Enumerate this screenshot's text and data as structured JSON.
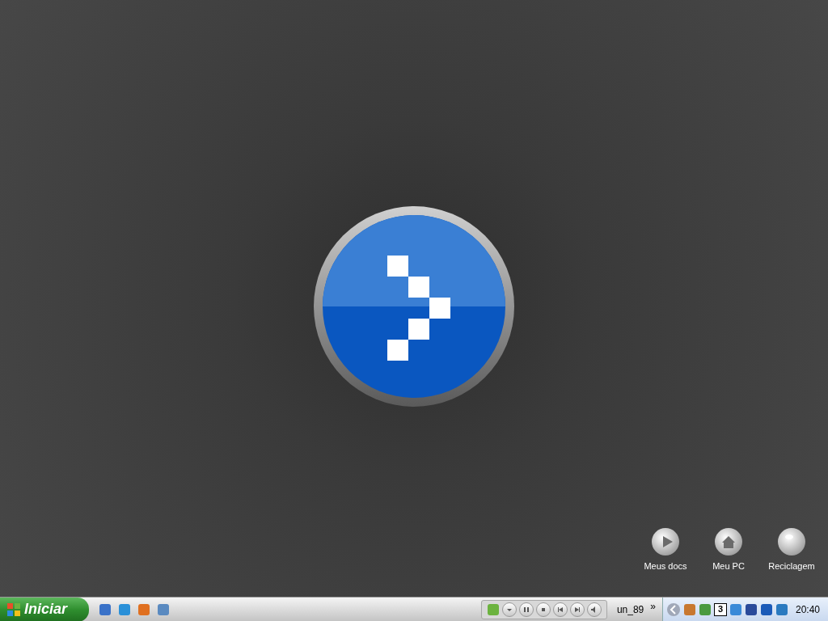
{
  "desktop_icons": [
    {
      "label": "Meus docs",
      "kind": "play"
    },
    {
      "label": "Meu PC",
      "kind": "home"
    },
    {
      "label": "Reciclagem",
      "kind": "orb"
    }
  ],
  "taskbar": {
    "start_button": "Iniciar",
    "toolbar_label": "un_89",
    "overflow_chevron": "»",
    "tray": {
      "calendar_day": "3",
      "clock": "20:40"
    }
  }
}
